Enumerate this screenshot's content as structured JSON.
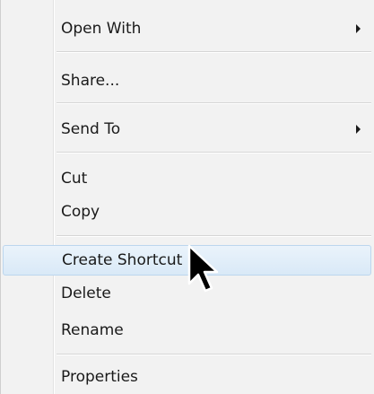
{
  "menu": {
    "items": [
      {
        "label": "Open With",
        "has_submenu": true
      },
      {
        "label": "Share...",
        "has_submenu": false
      },
      {
        "label": "Send To",
        "has_submenu": true
      },
      {
        "label": "Cut",
        "has_submenu": false
      },
      {
        "label": "Copy",
        "has_submenu": false
      },
      {
        "label": "Create Shortcut",
        "has_submenu": false,
        "highlighted": true
      },
      {
        "label": "Delete",
        "has_submenu": false
      },
      {
        "label": "Rename",
        "has_submenu": false
      },
      {
        "label": "Properties",
        "has_submenu": false
      }
    ]
  },
  "icons": {
    "submenu_arrow": "chevron-right-icon",
    "cursor": "mouse-pointer-icon"
  },
  "colors": {
    "menu_bg": "#f2f2f2",
    "highlight_bg": "#d9e9f7",
    "highlight_border": "#bcd6ee",
    "separator": "#d6d6d6"
  }
}
